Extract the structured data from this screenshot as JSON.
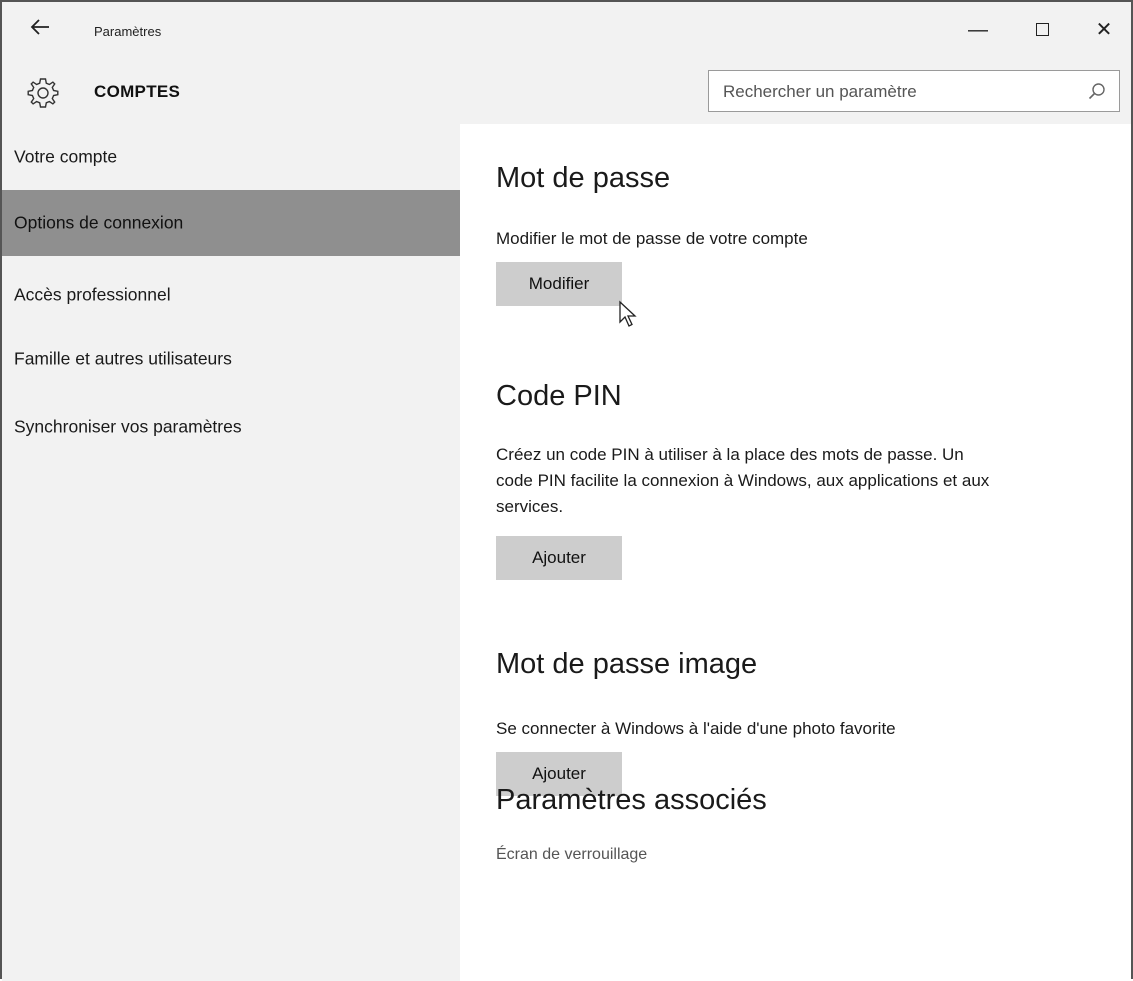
{
  "titlebar": {
    "back_icon": "back-arrow-icon",
    "app_title": "Paramètres",
    "minimize_glyph": "—",
    "close_glyph": "✕"
  },
  "header": {
    "icon": "gear-icon",
    "title": "COMPTES",
    "search": {
      "placeholder": "Rechercher un paramètre",
      "value": "",
      "icon": "search-icon"
    }
  },
  "sidebar": {
    "items": [
      {
        "label": "Votre compte",
        "active": false
      },
      {
        "label": "Options de connexion",
        "active": true
      },
      {
        "label": "Accès professionnel",
        "active": false
      },
      {
        "label": "Famille et autres utilisateurs",
        "active": false
      },
      {
        "label": "Synchroniser vos paramètres",
        "active": false
      }
    ],
    "active_color": "#8f8f8f"
  },
  "main": {
    "password": {
      "heading": "Mot de passe",
      "description": "Modifier le mot de passe de votre compte",
      "button": "Modifier"
    },
    "pin": {
      "heading": "Code PIN",
      "description_lines": [
        "Créez un code PIN à utiliser à la place des mots de passe. Un",
        "code PIN facilite la connexion à Windows, aux applications et aux",
        "services."
      ],
      "button": "Ajouter"
    },
    "picture_password": {
      "heading": "Mot de passe image",
      "description": "Se connecter à Windows à l'aide d'une photo favorite",
      "button": "Ajouter"
    },
    "related": {
      "heading": "Paramètres associés",
      "link": "Écran de verrouillage"
    }
  },
  "colors": {
    "chrome_bg": "#f2f2f2",
    "button_bg": "#cdcdcd",
    "link_color": "#555555"
  }
}
